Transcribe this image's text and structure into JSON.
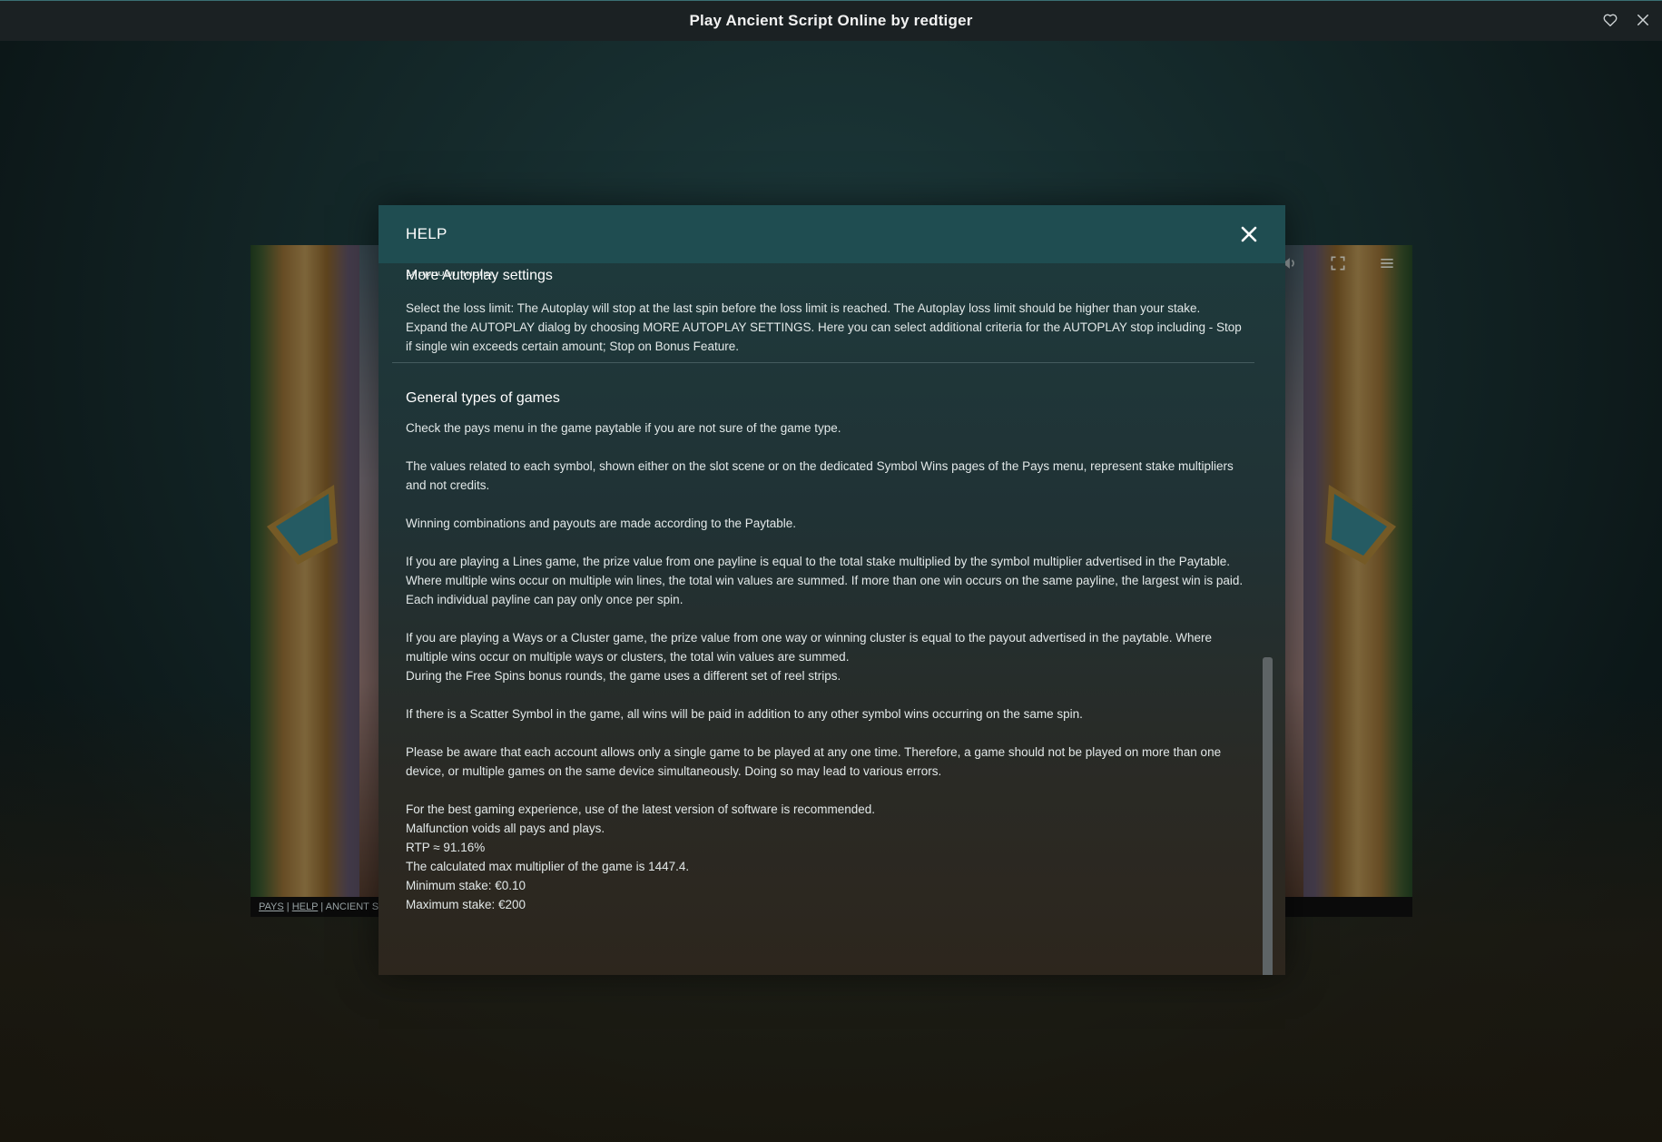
{
  "window": {
    "title": "Play Ancient Script Online by redtiger",
    "favorite_icon": "heart-outline-icon",
    "close_icon": "close-icon"
  },
  "game": {
    "links": [
      "PAYS",
      "HELP",
      "ANCIENT S"
    ],
    "controls": [
      "volume-icon",
      "fullscreen-icon",
      "menu-icon"
    ]
  },
  "dialog": {
    "title": "HELP",
    "cutoff_text": "Dropdown menu.",
    "sections": [
      {
        "heading": "More Autoplay settings",
        "paragraphs": [
          "Select the loss limit: The Autoplay will stop at the last spin before the loss limit is reached. The Autoplay loss limit should be higher than your stake.",
          "Expand the AUTOPLAY dialog by choosing MORE AUTOPLAY SETTINGS. Here you can select additional criteria for the AUTOPLAY stop including - Stop if single win exceeds certain amount; Stop on Bonus Feature."
        ]
      },
      {
        "heading": "General types of games",
        "paragraphs": [
          "Check the pays menu in the game paytable if you are not sure of the game type.",
          "The values related to each symbol, shown either on the slot scene or on the dedicated Symbol Wins pages of the Pays menu, represent stake multipliers and not credits.",
          "Winning combinations and payouts are made according to the Paytable.",
          "If you are playing a Lines game, the prize value from one payline is equal to the total stake multiplied by the symbol multiplier advertised in the Paytable. Where multiple wins occur on multiple win lines, the total win values are summed. If more than one win occurs on the same payline, the largest win is paid. Each individual payline can pay only once per spin.",
          "If you are playing a Ways or a Cluster game, the prize value from one way or winning cluster is equal to the payout advertised in the paytable. Where multiple wins occur on multiple ways or clusters, the total win values are summed.",
          "During the Free Spins bonus rounds, the game uses a different set of reel strips.",
          "If there is a Scatter Symbol in the game, all wins will be paid in addition to any other symbol wins occurring on the same spin.",
          "Please be aware that each account allows only a single game to be played at any one time. Therefore, a game should not be played on more than one device, or multiple games on the same device simultaneously. Doing so may lead to various errors.",
          "For the best gaming experience, use of the latest version of software is recommended.",
          "Malfunction voids all pays and plays.",
          "RTP ≈ 91.16%",
          "The calculated max multiplier of the game is 1447.4.",
          "Minimum stake: €0.10",
          "Maximum stake: €200"
        ]
      }
    ]
  },
  "colors": {
    "dialog_header": "#1f4d51",
    "topbar": "#1b2123",
    "scrollbar": "#5e6466"
  }
}
